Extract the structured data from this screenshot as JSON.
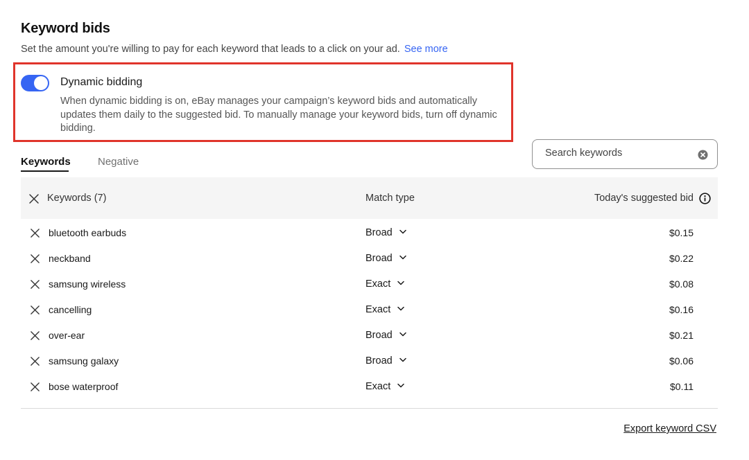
{
  "header": {
    "title": "Keyword bids",
    "subtitle": "Set the amount you're willing to pay for each keyword that leads to a click on your ad.",
    "see_more": "See more"
  },
  "dynamic_bidding": {
    "enabled": true,
    "title": "Dynamic bidding",
    "description": "When dynamic bidding is on, eBay manages your campaign’s keyword bids and automatically updates them daily to the suggested bid. To manually manage your keyword bids, turn off dynamic bidding."
  },
  "tabs": [
    {
      "label": "Keywords",
      "active": true
    },
    {
      "label": "Negative",
      "active": false
    }
  ],
  "search": {
    "placeholder": "Search keywords",
    "value": ""
  },
  "table": {
    "headers": {
      "keywords": "Keywords (7)",
      "match_type": "Match type",
      "suggested_bid": "Today's suggested bid"
    },
    "rows": [
      {
        "keyword": "bluetooth earbuds",
        "match": "Broad",
        "bid": "$0.15"
      },
      {
        "keyword": "neckband",
        "match": "Broad",
        "bid": "$0.22"
      },
      {
        "keyword": "samsung wireless",
        "match": "Exact",
        "bid": "$0.08"
      },
      {
        "keyword": "cancelling",
        "match": "Exact",
        "bid": "$0.16"
      },
      {
        "keyword": "over-ear",
        "match": "Broad",
        "bid": "$0.21"
      },
      {
        "keyword": "samsung galaxy",
        "match": "Broad",
        "bid": "$0.06"
      },
      {
        "keyword": "bose waterproof",
        "match": "Exact",
        "bid": "$0.11"
      }
    ]
  },
  "footer": {
    "export_label": "Export keyword CSV"
  },
  "colors": {
    "accent": "#3665f3",
    "highlight": "#e0342b"
  },
  "icons": {
    "toggle": "toggle-switch-icon",
    "remove": "close-icon",
    "info": "info-icon",
    "clear": "clear-circle-icon",
    "dropdown": "chevron-down-icon"
  }
}
